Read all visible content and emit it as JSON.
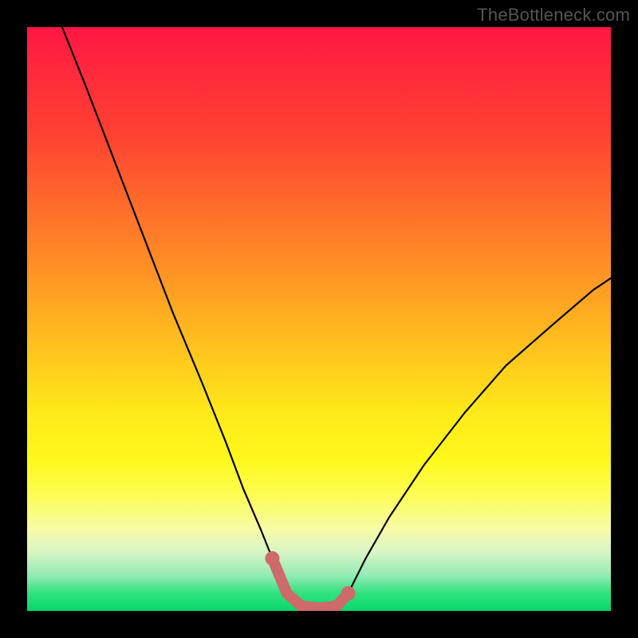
{
  "watermark": "TheBottleneck.com",
  "chart_data": {
    "type": "line",
    "title": "",
    "xlabel": "",
    "ylabel": "",
    "xlim": [
      0,
      100
    ],
    "ylim": [
      0,
      100
    ],
    "grid": false,
    "legend": false,
    "series": [
      {
        "name": "bottleneck-curve",
        "color": "#000000",
        "x": [
          6,
          10,
          15,
          20,
          25,
          30,
          34,
          37,
          40,
          42,
          44.5,
          47,
          50,
          53,
          55,
          58,
          62,
          68,
          75,
          82,
          90,
          97,
          100
        ],
        "values": [
          100,
          90,
          77,
          64,
          51,
          39,
          29,
          21,
          14,
          9,
          3,
          0.8,
          0.5,
          0.8,
          3,
          9,
          16,
          25,
          34,
          42,
          49,
          55,
          57
        ]
      },
      {
        "name": "bottom-highlight",
        "color": "#cf6a6a",
        "stroke_width": 14,
        "x": [
          42,
          44.5,
          47,
          50,
          53,
          55
        ],
        "values": [
          9,
          3,
          0.8,
          0.5,
          0.8,
          3
        ]
      }
    ],
    "highlight_points": {
      "color": "#cf6a6a",
      "points": [
        {
          "x": 42.0,
          "y": 9.0
        },
        {
          "x": 44.5,
          "y": 3.0
        },
        {
          "x": 47.0,
          "y": 0.8
        },
        {
          "x": 50.0,
          "y": 0.5
        },
        {
          "x": 53.0,
          "y": 0.8
        },
        {
          "x": 55.0,
          "y": 3.0
        }
      ]
    }
  }
}
